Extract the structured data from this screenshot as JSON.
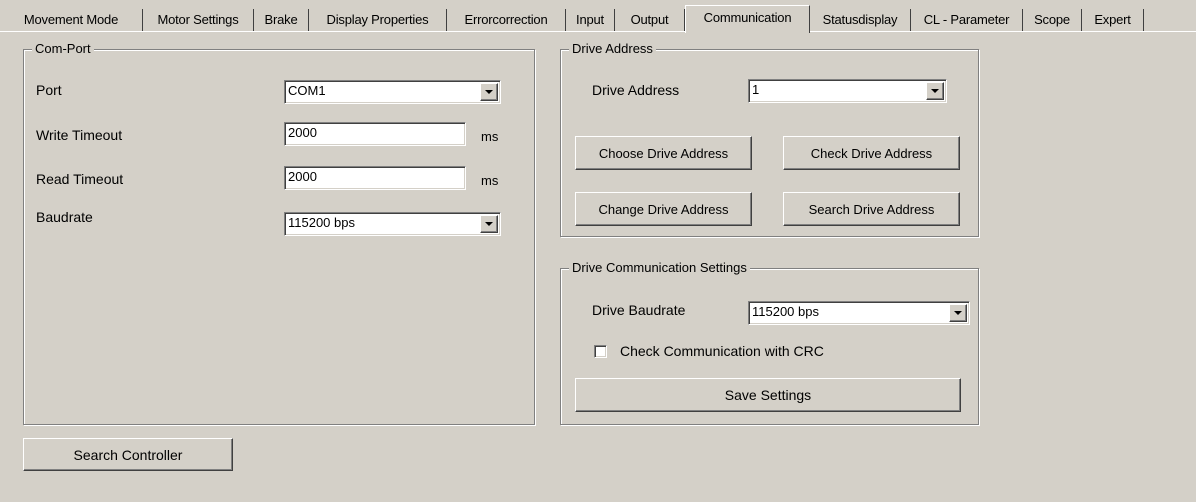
{
  "tabs": [
    {
      "label": "Movement Mode",
      "active": false
    },
    {
      "label": "Motor Settings",
      "active": false
    },
    {
      "label": "Brake",
      "active": false
    },
    {
      "label": "Display Properties",
      "active": false
    },
    {
      "label": "Errorcorrection",
      "active": false
    },
    {
      "label": "Input",
      "active": false
    },
    {
      "label": "Output",
      "active": false
    },
    {
      "label": "Communication",
      "active": true
    },
    {
      "label": "Statusdisplay",
      "active": false
    },
    {
      "label": "CL - Parameter",
      "active": false
    },
    {
      "label": "Scope",
      "active": false
    },
    {
      "label": "Expert",
      "active": false
    }
  ],
  "com_port": {
    "title": "Com-Port",
    "port_label": "Port",
    "port_value": "COM1",
    "write_timeout_label": "Write Timeout",
    "write_timeout_value": "2000",
    "write_timeout_unit": "ms",
    "read_timeout_label": "Read Timeout",
    "read_timeout_value": "2000",
    "read_timeout_unit": "ms",
    "baudrate_label": "Baudrate",
    "baudrate_value": "115200 bps"
  },
  "drive_address": {
    "title": "Drive Address",
    "address_label": "Drive Address",
    "address_value": "1",
    "choose_button": "Choose Drive Address",
    "check_button": "Check Drive Address",
    "change_button": "Change Drive Address",
    "search_button": "Search Drive Address"
  },
  "drive_comm": {
    "title": "Drive Communication Settings",
    "baudrate_label": "Drive Baudrate",
    "baudrate_value": "115200 bps",
    "crc_label": "Check Communication with CRC",
    "crc_checked": false,
    "save_button": "Save Settings"
  },
  "search_controller_button": "Search Controller",
  "colors": {
    "face": "#d4d0c8",
    "shadow": "#808080",
    "dark_shadow": "#404040",
    "highlight": "#ffffff"
  }
}
